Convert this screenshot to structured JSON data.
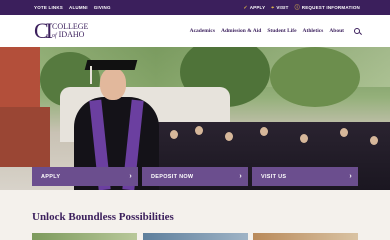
{
  "utility": {
    "left_links": [
      "YOTE LINKS",
      "ALUMNI",
      "GIVING"
    ],
    "right_links": [
      {
        "label": "APPLY",
        "icon": "check-icon"
      },
      {
        "label": "VISIT",
        "icon": "location-pin-icon"
      },
      {
        "label": "REQUEST INFORMATION",
        "icon": "info-icon"
      }
    ]
  },
  "logo": {
    "line1": "COLLEGE",
    "line2_prefix": "of",
    "line2": "IDAHO"
  },
  "nav": {
    "items": [
      "Academics",
      "Admission & Aid",
      "Student Life",
      "Athletics",
      "About"
    ]
  },
  "cta": {
    "buttons": [
      "APPLY",
      "DEPOSIT NOW",
      "VISIT US"
    ]
  },
  "section": {
    "title": "Unlock Boundless Possibilities"
  },
  "colors": {
    "brand_purple": "#3b1f5c",
    "cta_purple": "#6b4e8e",
    "gold": "#d9b24a"
  }
}
